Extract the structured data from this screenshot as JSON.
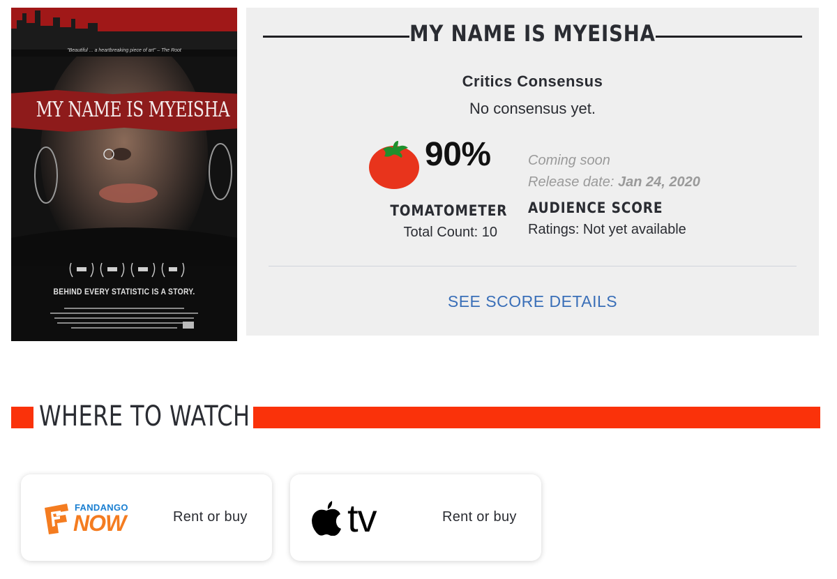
{
  "poster": {
    "tagline": "\"Beautiful ... a heartbreaking piece of art\" – The Root",
    "title": "MY NAME IS MYEISHA",
    "strapline": "BEHIND EVERY STATISTIC IS A STORY."
  },
  "score_panel": {
    "movie_title": "MY NAME IS MYEISHA",
    "consensus_heading": "Critics Consensus",
    "consensus_text": "No consensus yet.",
    "tomatometer": {
      "score": "90%",
      "label": "TOMATOMETER",
      "total_count": "Total Count: 10",
      "icon": "fresh-tomato-icon"
    },
    "audience": {
      "status": "Coming soon",
      "release_label": "Release date:",
      "release_value": "Jan 24, 2020",
      "label": "AUDIENCE SCORE",
      "ratings": "Ratings: Not yet available"
    },
    "details_link": "SEE SCORE DETAILS"
  },
  "where_to_watch": {
    "heading": "WHERE TO WATCH",
    "providers": [
      {
        "brand_top": "FANDANGO",
        "brand_bottom": "NOW",
        "logo": "fandango-now-logo",
        "action": "Rent or buy"
      },
      {
        "brand": "tv",
        "logo": "apple-tv-logo",
        "action": "Rent or buy"
      }
    ]
  },
  "colors": {
    "accent_red": "#fa320a",
    "link_blue": "#3a6fb8",
    "panel_bg": "#efefef",
    "tomato_red": "#e8341c",
    "fandango_orange": "#f47c20",
    "fandango_blue": "#1a7fd1"
  }
}
